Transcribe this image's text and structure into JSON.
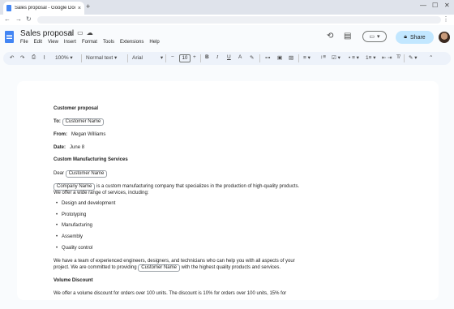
{
  "browser": {
    "tab_title": "Sales proposal - Google Docs",
    "new_tab": "+",
    "close_tab": "×",
    "minimize": "—",
    "maximize": "☐",
    "close_window": "✕"
  },
  "docs": {
    "title": "Sales proposal",
    "menu": [
      "File",
      "Edit",
      "View",
      "Insert",
      "Format",
      "Tools",
      "Extensions",
      "Help"
    ],
    "share_label": "Share"
  },
  "toolbar": {
    "zoom": "100%",
    "style": "Normal text",
    "font": "Arial",
    "font_size": "10"
  },
  "document": {
    "heading": "Customer proposal",
    "to_label": "To:",
    "to_chip": "Customer Name",
    "from_label": "From:",
    "from_value": "Megan Williams",
    "date_label": "Date:",
    "date_value": "June 8",
    "company_heading": "Custom Manufacturing Services",
    "dear": "Dear",
    "dear_chip": "Customer Name",
    "company_chip": "Company Name",
    "intro_text": " is a custom manufacturing company that specializes in the production of high-quality products.",
    "intro_text2": "We offer a wide range of services, including:",
    "services": [
      "Design and development",
      "Prototyping",
      "Manufacturing",
      "Assembly",
      "Quality control"
    ],
    "team_text1": "We have a team of experienced engineers, designers, and technicians who can help you with all aspects of your",
    "team_text2a": "project. We are committed to providing ",
    "team_chip": "Customer Name",
    "team_text2b": " with the highest quality products and services.",
    "volume_heading": "Volume Discount",
    "volume_text": "We offer a volume discount for orders over 100 units. The discount is 10% for orders over 100 units, 15% for"
  }
}
